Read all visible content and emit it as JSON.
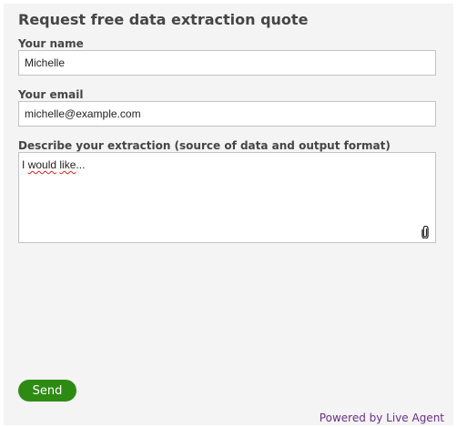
{
  "form": {
    "title": "Request free data extraction quote",
    "name_label": "Your name",
    "name_value": "Michelle",
    "email_label": "Your email",
    "email_value": "michelle@example.com",
    "description_label": "Describe your extraction (source of data and output format)",
    "description_value": {
      "word1": "I",
      "word2": "would",
      "word3": "like",
      "suffix": "..."
    },
    "attach_icon": "paperclip-icon",
    "send_label": "Send"
  },
  "footer": {
    "powered_by": "Powered by Live Agent"
  },
  "colors": {
    "panel_background": "#f4f4f4",
    "send_button": "#2e8b12",
    "powered_by_link": "#6a2f8a",
    "spellcheck_underline": "#e02020"
  }
}
